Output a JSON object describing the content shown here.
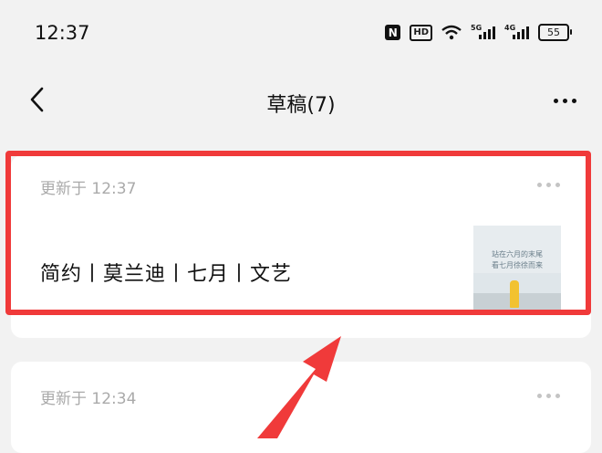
{
  "status_bar": {
    "time": "12:37",
    "nfc": "N",
    "hd": "HD",
    "signal_1": "5G",
    "signal_2": "4G",
    "battery": "55"
  },
  "nav": {
    "title": "草稿(7)",
    "back_icon": "chevron-left-icon",
    "more_icon": "more-horizontal-icon"
  },
  "drafts": [
    {
      "updated": "更新于 12:37",
      "title": "简约丨莫兰迪丨七月丨文艺",
      "thumbnail_text": [
        "站在六月的末尾",
        "看七月徐徐而来"
      ]
    },
    {
      "updated": "更新于 12:34"
    }
  ],
  "colors": {
    "highlight": "#f03a3a",
    "background": "#f2f2f2"
  }
}
